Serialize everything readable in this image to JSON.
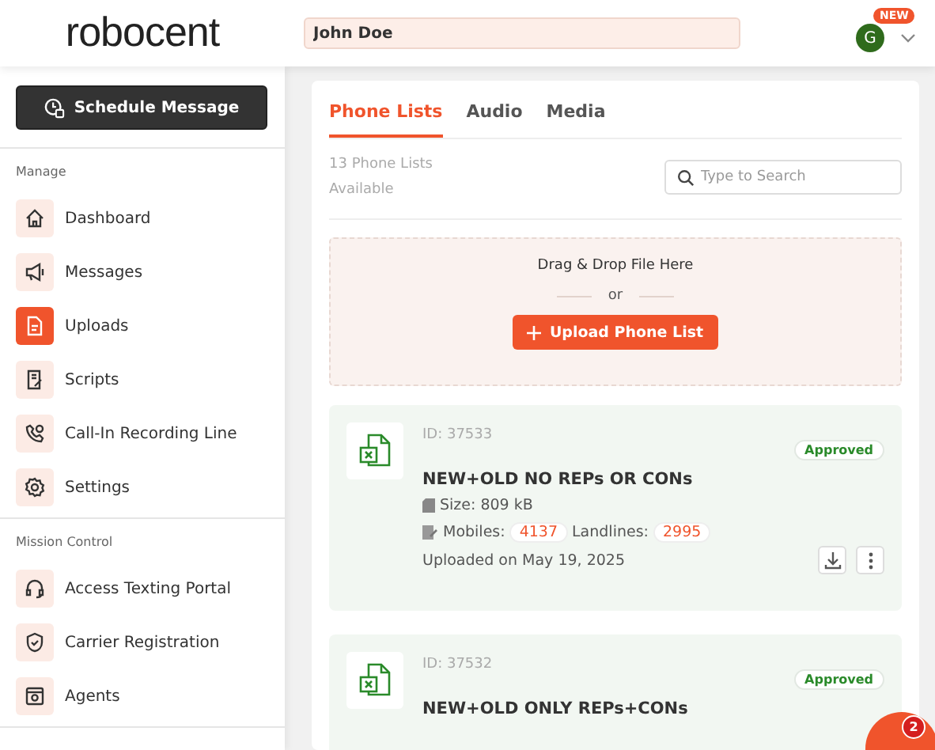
{
  "logo": "robocent",
  "header": {
    "name_value": "John Doe",
    "avatar": "G",
    "new_badge": "NEW"
  },
  "schedule_button": "Schedule Message",
  "sidebar": [
    {
      "heading": "Manage",
      "items": [
        {
          "label": "Dashboard",
          "selected": false
        },
        {
          "label": "Messages",
          "selected": false
        },
        {
          "label": "Uploads",
          "selected": true
        },
        {
          "label": "Scripts",
          "selected": false
        },
        {
          "label": "Call-In Recording Line",
          "selected": false
        },
        {
          "label": "Settings",
          "selected": false
        }
      ]
    },
    {
      "heading": "Mission Control",
      "items": [
        {
          "label": "Access Texting Portal",
          "selected": false
        },
        {
          "label": "Carrier Registration",
          "selected": false
        },
        {
          "label": "Agents",
          "selected": false
        }
      ]
    }
  ],
  "tabs": [
    {
      "label": "Phone Lists",
      "selected": true
    },
    {
      "label": "Audio",
      "selected": false
    },
    {
      "label": "Media",
      "selected": false
    }
  ],
  "count_text": "13 Phone Lists Available",
  "search": {
    "placeholder": "Type to Search"
  },
  "dropzone": {
    "text": "Drag & Drop File Here",
    "or": "or",
    "button": "Upload Phone List"
  },
  "lists": [
    {
      "id": "ID: 37533",
      "status": "Approved",
      "title": "NEW+OLD NO REPs OR CONs",
      "size": "Size: 809 kB",
      "mobiles_label": "Mobiles:",
      "mobiles": "4137",
      "landlines_label": "Landlines:",
      "landlines": "2995",
      "uploaded": "Uploaded on May 19, 2025"
    },
    {
      "id": "ID: 37532",
      "status": "Approved",
      "title": "NEW+OLD ONLY REPs+CONs"
    }
  ],
  "chat": {
    "badge": "2"
  }
}
